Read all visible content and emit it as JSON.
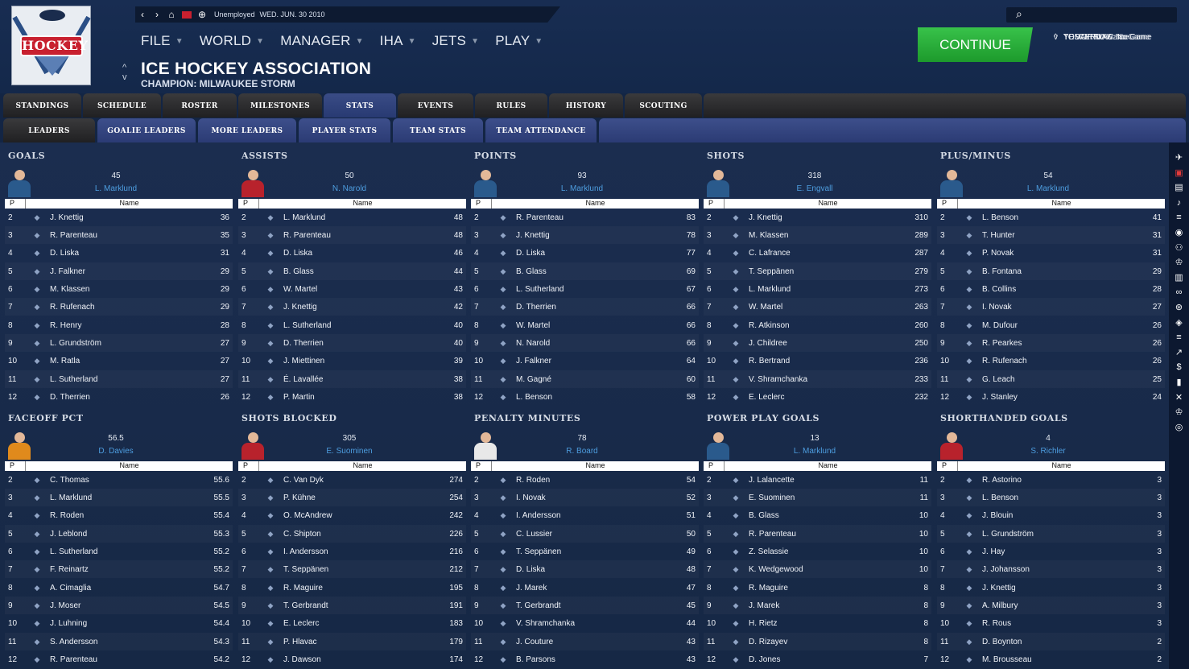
{
  "topnav": {
    "status": "Unemployed",
    "date": "WED. JUN. 30 2010"
  },
  "logo": {
    "text": "HOCKEY"
  },
  "menu": [
    "FILE",
    "WORLD",
    "MANAGER",
    "IHA",
    "JETS",
    "PLAY"
  ],
  "league": {
    "name": "ICE HOCKEY ASSOCIATION",
    "champion": "CHAMPION: MILWAUKEE STORM"
  },
  "continue_label": "CONTINUE",
  "schedule": {
    "yesterday": "YESTERDAY: No Game",
    "today": "TODAY: No Game",
    "tomorrow": "TOMORROW: No Game"
  },
  "tabs": [
    "STANDINGS",
    "SCHEDULE",
    "ROSTER",
    "MILESTONES",
    "STATS",
    "EVENTS",
    "RULES",
    "HISTORY",
    "SCOUTING"
  ],
  "active_tab": "STATS",
  "subtabs": [
    "LEADERS",
    "GOALIE LEADERS",
    "MORE LEADERS",
    "PLAYER STATS",
    "TEAM STATS",
    "TEAM ATTENDANCE"
  ],
  "active_subtab": "LEADERS",
  "table_headers": {
    "p": "P",
    "name": "Name"
  },
  "panels": [
    {
      "title": "GOALS",
      "leader_value": "45",
      "leader_name": "L. Marklund",
      "team_logo": "Milwaukee",
      "jersey_color": "#2a5a8c",
      "rows": [
        [
          "2",
          "J. Knettig",
          "36"
        ],
        [
          "3",
          "R. Parenteau",
          "35"
        ],
        [
          "4",
          "D. Liska",
          "31"
        ],
        [
          "5",
          "J. Falkner",
          "29"
        ],
        [
          "6",
          "M. Klassen",
          "29"
        ],
        [
          "7",
          "R. Rufenach",
          "29"
        ],
        [
          "8",
          "R. Henry",
          "28"
        ],
        [
          "9",
          "L. Grundström",
          "27"
        ],
        [
          "10",
          "M. Ratla",
          "27"
        ],
        [
          "11",
          "L. Sutherland",
          "27"
        ],
        [
          "12",
          "D. Therrien",
          "26"
        ]
      ]
    },
    {
      "title": "ASSISTS",
      "leader_value": "50",
      "leader_name": "N. Narold",
      "team_logo": "red-white-logo",
      "jersey_color": "#b8222c",
      "rows": [
        [
          "2",
          "L. Marklund",
          "48"
        ],
        [
          "3",
          "R. Parenteau",
          "48"
        ],
        [
          "4",
          "D. Liska",
          "46"
        ],
        [
          "5",
          "B. Glass",
          "44"
        ],
        [
          "6",
          "W. Martel",
          "43"
        ],
        [
          "7",
          "J. Knettig",
          "42"
        ],
        [
          "8",
          "L. Sutherland",
          "40"
        ],
        [
          "9",
          "D. Therrien",
          "40"
        ],
        [
          "10",
          "J. Miettinen",
          "39"
        ],
        [
          "11",
          "É. Lavallée",
          "38"
        ],
        [
          "12",
          "P. Martin",
          "38"
        ]
      ]
    },
    {
      "title": "POINTS",
      "leader_value": "93",
      "leader_name": "L. Marklund",
      "team_logo": "Milwaukee",
      "jersey_color": "#2a5a8c",
      "rows": [
        [
          "2",
          "R. Parenteau",
          "83"
        ],
        [
          "3",
          "J. Knettig",
          "78"
        ],
        [
          "4",
          "D. Liska",
          "77"
        ],
        [
          "5",
          "B. Glass",
          "69"
        ],
        [
          "6",
          "L. Sutherland",
          "67"
        ],
        [
          "7",
          "D. Therrien",
          "66"
        ],
        [
          "8",
          "W. Martel",
          "66"
        ],
        [
          "9",
          "N. Narold",
          "66"
        ],
        [
          "10",
          "J. Falkner",
          "64"
        ],
        [
          "11",
          "M. Gagné",
          "60"
        ],
        [
          "12",
          "L. Benson",
          "58"
        ]
      ]
    },
    {
      "title": "SHOTS",
      "leader_value": "318",
      "leader_name": "E. Engvall",
      "team_logo": "Milwaukee",
      "jersey_color": "#2a5a8c",
      "rows": [
        [
          "2",
          "J. Knettig",
          "310"
        ],
        [
          "3",
          "M. Klassen",
          "289"
        ],
        [
          "4",
          "C. Lafrance",
          "287"
        ],
        [
          "5",
          "T. Seppänen",
          "279"
        ],
        [
          "6",
          "L. Marklund",
          "273"
        ],
        [
          "7",
          "W. Martel",
          "263"
        ],
        [
          "8",
          "R. Atkinson",
          "260"
        ],
        [
          "9",
          "J. Childree",
          "250"
        ],
        [
          "10",
          "R. Bertrand",
          "236"
        ],
        [
          "11",
          "V. Shramchanka",
          "233"
        ],
        [
          "12",
          "E. Leclerc",
          "232"
        ]
      ]
    },
    {
      "title": "PLUS/MINUS",
      "leader_value": "54",
      "leader_name": "L. Marklund",
      "team_logo": "Milwaukee",
      "jersey_color": "#2a5a8c",
      "rows": [
        [
          "2",
          "L. Benson",
          "41"
        ],
        [
          "3",
          "T. Hunter",
          "31"
        ],
        [
          "4",
          "P. Novak",
          "31"
        ],
        [
          "5",
          "B. Fontana",
          "29"
        ],
        [
          "6",
          "B. Collins",
          "28"
        ],
        [
          "7",
          "I. Novak",
          "27"
        ],
        [
          "8",
          "M. Dufour",
          "26"
        ],
        [
          "9",
          "R. Pearkes",
          "26"
        ],
        [
          "10",
          "R. Rufenach",
          "26"
        ],
        [
          "11",
          "G. Leach",
          "25"
        ],
        [
          "12",
          "J. Stanley",
          "24"
        ]
      ]
    },
    {
      "title": "FACEOFF PCT",
      "leader_value": "56.5",
      "leader_name": "D. Davies",
      "team_logo": "B-logo",
      "jersey_color": "#e08a1c",
      "rows": [
        [
          "2",
          "C. Thomas",
          "55.6"
        ],
        [
          "3",
          "L. Marklund",
          "55.5"
        ],
        [
          "4",
          "R. Roden",
          "55.4"
        ],
        [
          "5",
          "J. Leblond",
          "55.3"
        ],
        [
          "6",
          "L. Sutherland",
          "55.2"
        ],
        [
          "7",
          "F. Reinartz",
          "55.2"
        ],
        [
          "8",
          "A. Cimaglia",
          "54.7"
        ],
        [
          "9",
          "J. Moser",
          "54.5"
        ],
        [
          "10",
          "J. Luhning",
          "54.4"
        ],
        [
          "11",
          "S. Andersson",
          "54.3"
        ],
        [
          "12",
          "R. Parenteau",
          "54.2"
        ]
      ]
    },
    {
      "title": "SHOTS BLOCKED",
      "leader_value": "305",
      "leader_name": "E. Suominen",
      "team_logo": "red-white-logo",
      "jersey_color": "#b8222c",
      "rows": [
        [
          "2",
          "C. Van Dyk",
          "274"
        ],
        [
          "3",
          "P. Kühne",
          "254"
        ],
        [
          "4",
          "O. McAndrew",
          "242"
        ],
        [
          "5",
          "C. Shipton",
          "226"
        ],
        [
          "6",
          "I. Andersson",
          "216"
        ],
        [
          "7",
          "T. Seppänen",
          "212"
        ],
        [
          "8",
          "R. Maguire",
          "195"
        ],
        [
          "9",
          "T. Gerbrandt",
          "191"
        ],
        [
          "10",
          "E. Leclerc",
          "183"
        ],
        [
          "11",
          "P. Hlavac",
          "179"
        ],
        [
          "12",
          "J. Dawson",
          "174"
        ]
      ]
    },
    {
      "title": "PENALTY MINUTES",
      "leader_value": "78",
      "leader_name": "R. Board",
      "team_logo": "claw-logo",
      "jersey_color": "#e8e8e8",
      "rows": [
        [
          "2",
          "R. Roden",
          "54"
        ],
        [
          "3",
          "I. Novak",
          "52"
        ],
        [
          "4",
          "I. Andersson",
          "51"
        ],
        [
          "5",
          "C. Lussier",
          "50"
        ],
        [
          "6",
          "T. Seppänen",
          "49"
        ],
        [
          "7",
          "D. Liska",
          "48"
        ],
        [
          "8",
          "J. Marek",
          "47"
        ],
        [
          "9",
          "T. Gerbrandt",
          "45"
        ],
        [
          "10",
          "V. Shramchanka",
          "44"
        ],
        [
          "11",
          "J. Couture",
          "43"
        ],
        [
          "12",
          "B. Parsons",
          "43"
        ]
      ]
    },
    {
      "title": "POWER PLAY GOALS",
      "leader_value": "13",
      "leader_name": "L. Marklund",
      "team_logo": "Milwaukee",
      "jersey_color": "#2a5a8c",
      "rows": [
        [
          "2",
          "J. Lalancette",
          "11"
        ],
        [
          "3",
          "E. Suominen",
          "11"
        ],
        [
          "4",
          "B. Glass",
          "10"
        ],
        [
          "5",
          "R. Parenteau",
          "10"
        ],
        [
          "6",
          "Z. Selassie",
          "10"
        ],
        [
          "7",
          "K. Wedgewood",
          "10"
        ],
        [
          "8",
          "R. Maguire",
          "8"
        ],
        [
          "9",
          "J. Marek",
          "8"
        ],
        [
          "10",
          "H. Rietz",
          "8"
        ],
        [
          "11",
          "D. Rizayev",
          "8"
        ],
        [
          "12",
          "D. Jones",
          "7"
        ]
      ]
    },
    {
      "title": "SHORTHANDED GOALS",
      "leader_value": "4",
      "leader_name": "S. Richler",
      "team_logo": "blue-red-logo",
      "jersey_color": "#b8222c",
      "rows": [
        [
          "2",
          "R. Astorino",
          "3"
        ],
        [
          "3",
          "L. Benson",
          "3"
        ],
        [
          "4",
          "J. Blouin",
          "3"
        ],
        [
          "5",
          "L. Grundström",
          "3"
        ],
        [
          "6",
          "J. Hay",
          "3"
        ],
        [
          "7",
          "J. Johansson",
          "3"
        ],
        [
          "8",
          "J. Knettig",
          "3"
        ],
        [
          "9",
          "A. Milbury",
          "3"
        ],
        [
          "10",
          "R. Rous",
          "3"
        ],
        [
          "11",
          "D. Boynton",
          "2"
        ],
        [
          "12",
          "M. Brousseau",
          "2"
        ]
      ]
    }
  ],
  "sidebar_icons": [
    "plane-icon",
    "notification-icon",
    "clipboard-icon",
    "whistle-icon",
    "list-icon",
    "puck-icon",
    "people-icon",
    "trophy-icon",
    "document-icon",
    "handshake-icon",
    "stats-icon",
    "league-logo-icon",
    "list-icon",
    "chart-icon",
    "dollar-icon",
    "bar-chart-icon",
    "sticks-icon",
    "trophy-icon",
    "binoculars-icon"
  ]
}
